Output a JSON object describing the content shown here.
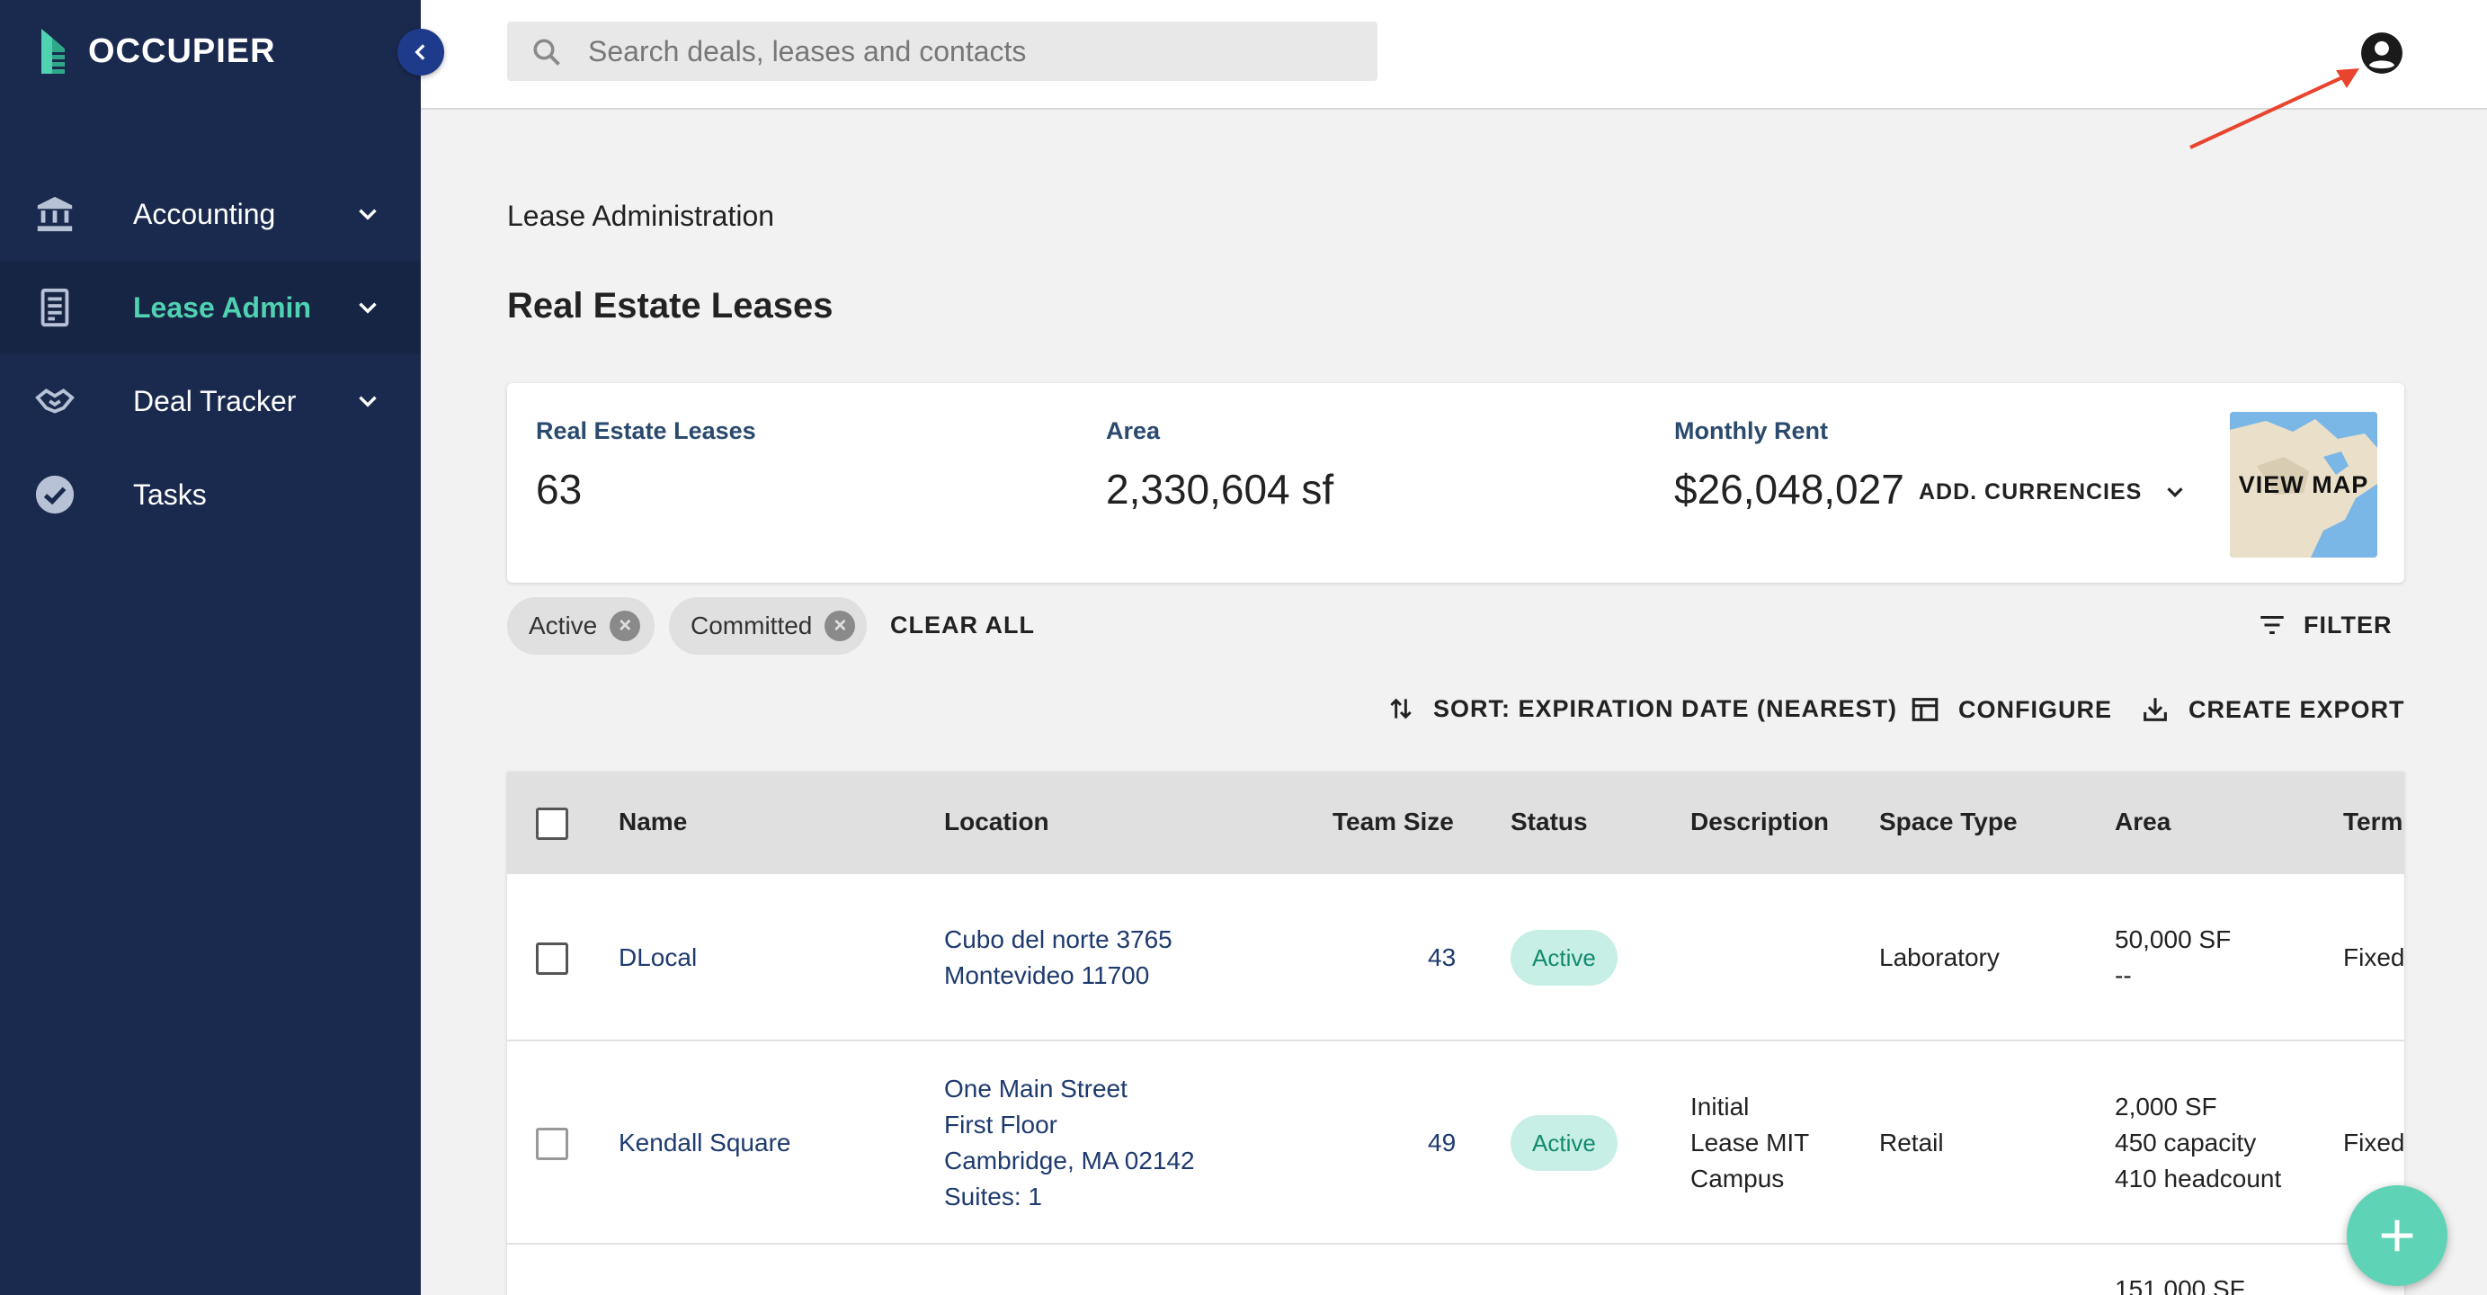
{
  "brand": {
    "name": "OCCUPIER"
  },
  "sidebar": {
    "items": [
      {
        "label": "Accounting",
        "icon": "bank-icon"
      },
      {
        "label": "Lease Admin",
        "icon": "document-icon",
        "active": true
      },
      {
        "label": "Deal Tracker",
        "icon": "handshake-icon"
      },
      {
        "label": "Tasks",
        "icon": "check-circle-icon"
      }
    ]
  },
  "search": {
    "placeholder": "Search deals, leases and contacts"
  },
  "breadcrumb": "Lease Administration",
  "page_title": "Real Estate Leases",
  "summary": {
    "leases_label": "Real Estate Leases",
    "leases_value": "63",
    "area_label": "Area",
    "area_value": "2,330,604 sf",
    "rent_label": "Monthly Rent",
    "rent_value": "$26,048,027",
    "add_currencies": "ADD. CURRENCIES",
    "view_map": "VIEW MAP"
  },
  "filters": {
    "chips": [
      "Active",
      "Committed"
    ],
    "clear_all": "CLEAR ALL",
    "filter_label": "FILTER"
  },
  "toolbar": {
    "sort": "SORT: EXPIRATION DATE (NEAREST)",
    "configure": "CONFIGURE",
    "export": "CREATE EXPORT"
  },
  "table": {
    "columns": [
      "Name",
      "Location",
      "Team Size",
      "Status",
      "Description",
      "Space Type",
      "Area",
      "Term"
    ],
    "rows": [
      {
        "name": "DLocal",
        "location": [
          "Cubo del norte 3765",
          "Montevideo 11700"
        ],
        "team_size": "43",
        "status": "Active",
        "description": [],
        "space_type": "Laboratory",
        "area": [
          "50,000 SF",
          "--"
        ],
        "term": "Fixed"
      },
      {
        "name": "Kendall Square",
        "location": [
          "One Main Street",
          "First Floor",
          "Cambridge, MA 02142",
          "Suites: 1"
        ],
        "team_size": "49",
        "status": "Active",
        "description": [
          "Initial",
          "Lease MIT",
          "Campus"
        ],
        "space_type": "Retail",
        "area": [
          "2,000 SF",
          "450 capacity",
          "410 headcount"
        ],
        "term": "Fixed"
      },
      {
        "area": [
          "151,000 SF"
        ]
      }
    ]
  },
  "colors": {
    "sidebar_bg": "#1a2a4e",
    "accent": "#4fd1b2",
    "active_badge_bg": "#c7efe6",
    "fab": "#5fd3b6",
    "annotation_arrow": "#e8442e"
  }
}
